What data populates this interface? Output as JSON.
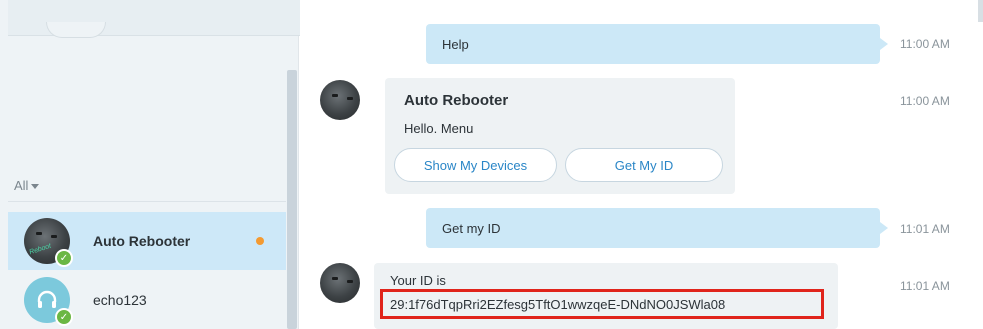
{
  "sidebar": {
    "filter_label": "All",
    "contacts": [
      {
        "name": "Auto Rebooter",
        "avatar_text": "Reboot",
        "status": "online",
        "unread": true,
        "active": true
      },
      {
        "name": "echo123",
        "avatar_icon": "headset-icon",
        "status": "online",
        "unread": false,
        "active": false
      }
    ]
  },
  "chat": {
    "messages": [
      {
        "direction": "out",
        "text": "Help",
        "time": "11:00 AM"
      },
      {
        "direction": "in",
        "sender": "Auto Rebooter",
        "text": "Hello. Menu",
        "buttons": [
          "Show My Devices",
          "Get My ID"
        ],
        "time": "11:00 AM"
      },
      {
        "direction": "out",
        "text": "Get my ID",
        "time": "11:01 AM"
      },
      {
        "direction": "in",
        "text": "Your ID is",
        "id_value": "29:1f76dTqpRri2EZfesg5TftO1wwzqeE-DNdNO0JSWla08",
        "time": "11:01 AM"
      }
    ]
  },
  "colors": {
    "outgoing_bubble": "#cce8f7",
    "incoming_bubble": "#eef2f4",
    "active_contact": "#cde8f8",
    "unread_dot": "#f49a31",
    "online_status": "#6bb744",
    "highlight_border": "#e0241b",
    "button_text": "#2a86c7"
  }
}
